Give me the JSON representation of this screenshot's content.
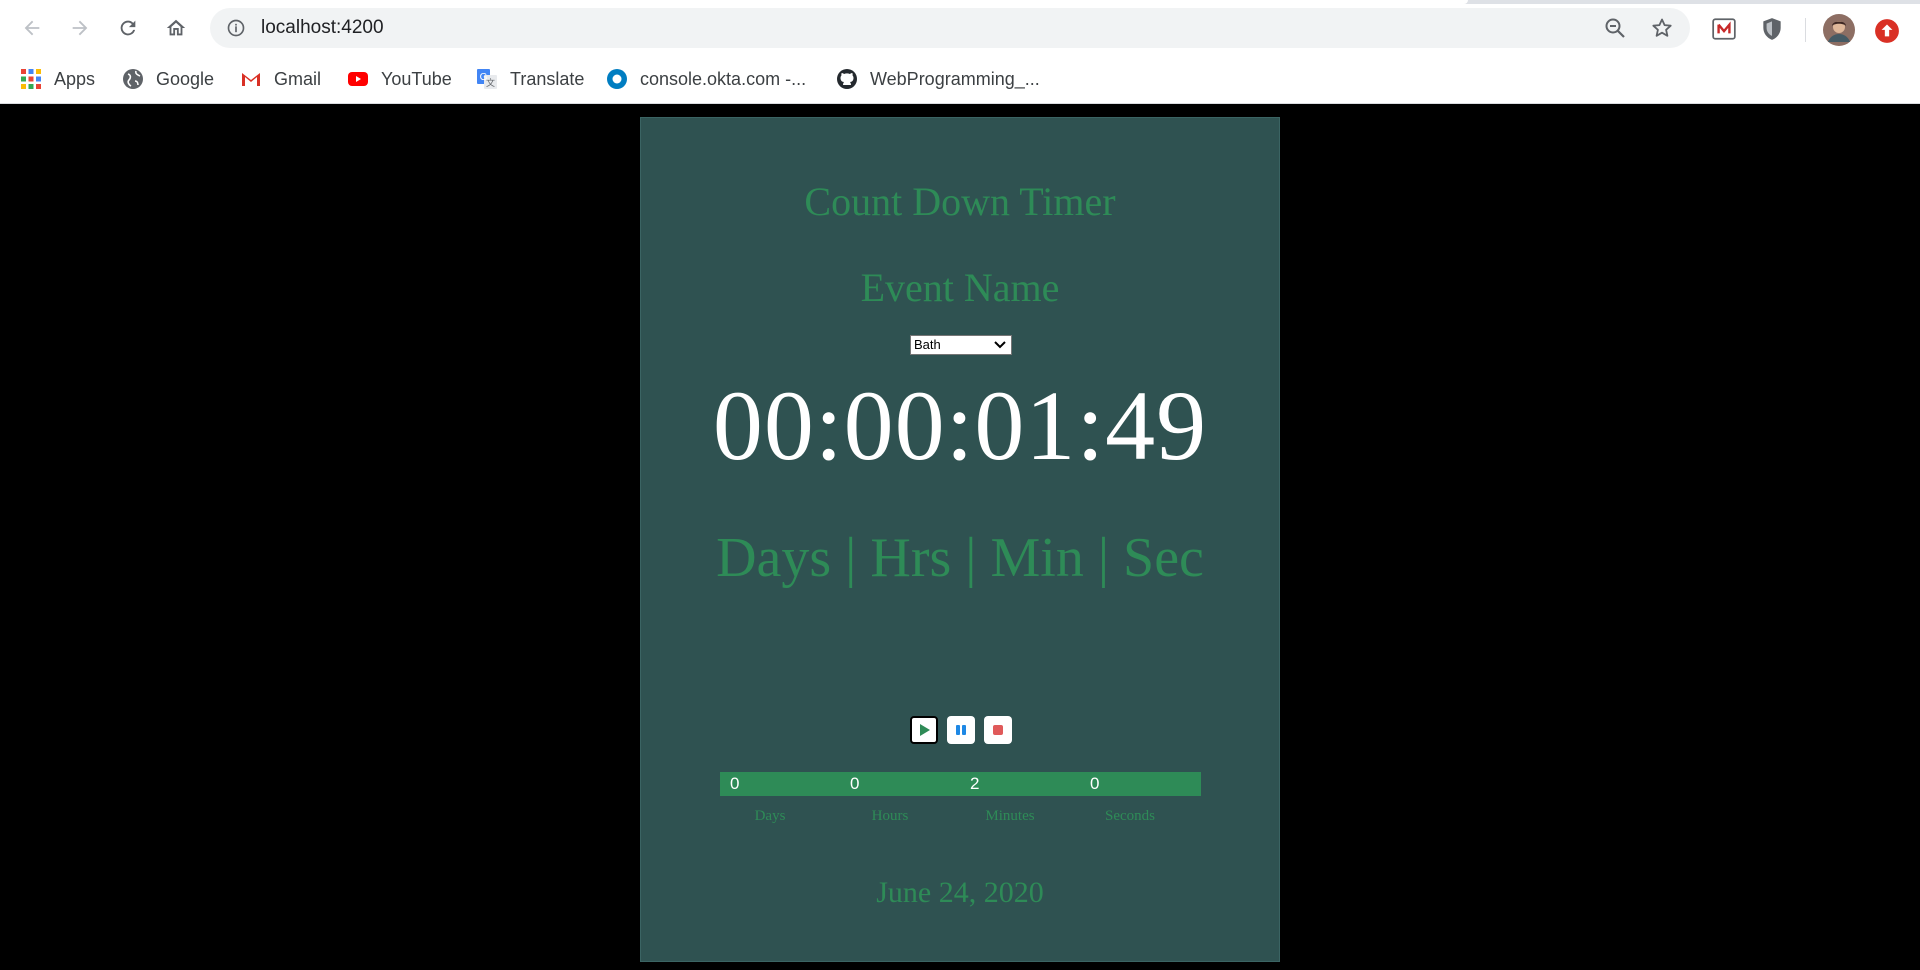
{
  "browser": {
    "url": "localhost:4200",
    "bookmarks": [
      {
        "label": "Apps",
        "icon": "apps-grid-icon"
      },
      {
        "label": "Google",
        "icon": "globe-icon"
      },
      {
        "label": "Gmail",
        "icon": "gmail-icon"
      },
      {
        "label": "YouTube",
        "icon": "youtube-icon"
      },
      {
        "label": "Translate",
        "icon": "translate-icon"
      },
      {
        "label": "console.okta.com -...",
        "icon": "okta-icon"
      },
      {
        "label": "WebProgramming_...",
        "icon": "github-icon"
      }
    ]
  },
  "timer": {
    "title": "Count Down Timer",
    "event_label": "Event Name",
    "selected_event": "Bath",
    "countdown": "00:00:01:49",
    "units_caption": "Days | Hrs | Min | Sec",
    "stats": [
      {
        "value": "0",
        "label": "Days"
      },
      {
        "value": "0",
        "label": "Hours"
      },
      {
        "value": "2",
        "label": "Minutes"
      },
      {
        "value": "0",
        "label": "Seconds"
      }
    ],
    "date": "June 24, 2020"
  },
  "colors": {
    "card_bg": "#2f5251",
    "accent_green": "#2e8b57",
    "page_bg": "#000000"
  }
}
